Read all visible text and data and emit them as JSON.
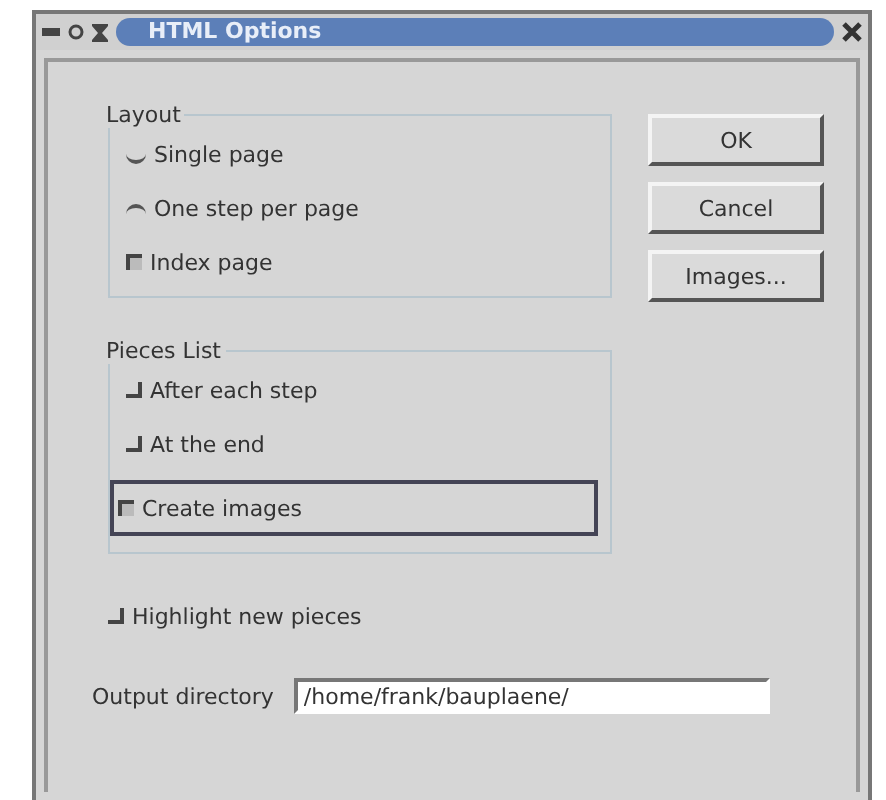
{
  "window": {
    "title": "HTML Options"
  },
  "layout": {
    "label": "Layout",
    "options": [
      {
        "kind": "radio",
        "label": "Single page",
        "selected": false
      },
      {
        "kind": "radio",
        "label": "One step per page",
        "selected": true
      },
      {
        "kind": "checkbox",
        "label": "Index page",
        "checked": true
      }
    ]
  },
  "pieces_list": {
    "label": "Pieces List",
    "options": [
      {
        "kind": "checkbox",
        "label": "After each step",
        "checked": false,
        "focused": false
      },
      {
        "kind": "checkbox",
        "label": "At the end",
        "checked": false,
        "focused": false
      },
      {
        "kind": "checkbox",
        "label": "Create images",
        "checked": true,
        "focused": true
      }
    ]
  },
  "highlight": {
    "label": "Highlight new pieces",
    "checked": false
  },
  "output_directory": {
    "label": "Output directory",
    "value": "/home/frank/bauplaene/"
  },
  "buttons": [
    "OK",
    "Cancel",
    "Images..."
  ]
}
